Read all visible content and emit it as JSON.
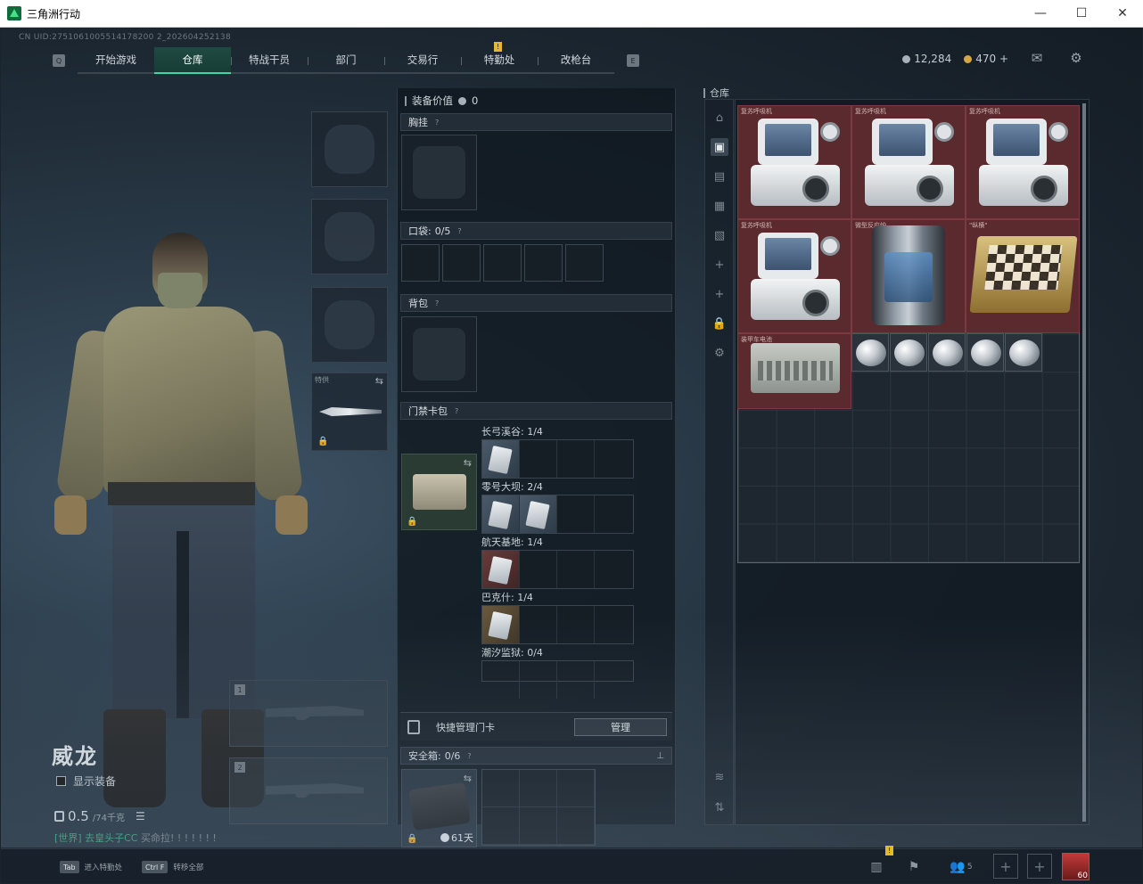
{
  "window": {
    "title": "三角洲行动",
    "minimize": "—",
    "maximize": "☐",
    "close": "✕"
  },
  "uid": "CN UID:2751061005514178200 2_202604252138",
  "nav": {
    "left_key": "Q",
    "right_key": "E",
    "tabs": [
      "开始游戏",
      "仓库",
      "特战干员",
      "部门",
      "交易行",
      "特勤处",
      "改枪台"
    ],
    "active_tab": "仓库",
    "alert_badge": "!"
  },
  "currency": {
    "silver": "12,284",
    "gold": "470 +"
  },
  "icons": {
    "mail": "mail-icon",
    "settings": "gear-icon"
  },
  "character": {
    "name": "威龙",
    "show_gear_label": "显示装备",
    "weight_value": "0.5",
    "weight_capacity": "/74千克",
    "chat_channel": "[世界] 去皇头子CC",
    "chat_message": "买命拉! ! ! ! ! ! !"
  },
  "equipment": {
    "melee_label": "特供",
    "swap_glyph": "⇆",
    "weapon_slot_1": "1",
    "weapon_slot_2": "2"
  },
  "gear_panel": {
    "value_label": "装备价值",
    "value": "0",
    "chest_rig": "胸挂",
    "pockets_label": "口袋:",
    "pockets_count": "0/5",
    "backpack": "背包",
    "keycard_case": "门禁卡包",
    "maps": [
      {
        "name": "长弓溪谷: 1/4"
      },
      {
        "name": "零号大坝: 2/4"
      },
      {
        "name": "航天基地: 1/4"
      },
      {
        "name": "巴克什: 1/4"
      },
      {
        "name": "潮汐监狱: 0/4"
      }
    ],
    "quick_manage_label": "快捷管理门卡",
    "manage_button": "管理",
    "safebox_label": "安全箱:",
    "safebox_count": "0/6",
    "safebox_days": "61天",
    "pin_glyph": "📌",
    "help_glyph": "?"
  },
  "warehouse": {
    "label": "仓库",
    "items": [
      {
        "name": "复苏呼吸机",
        "kind": "monitor"
      },
      {
        "name": "复苏呼吸机",
        "kind": "monitor"
      },
      {
        "name": "复苏呼吸机",
        "kind": "monitor"
      },
      {
        "name": "复苏呼吸机",
        "kind": "monitor"
      },
      {
        "name": "微型反应炉",
        "kind": "reactor"
      },
      {
        "name": "\"纵横\"",
        "kind": "chess"
      },
      {
        "name": "装甲车电池",
        "kind": "battery"
      }
    ],
    "diamond_count": 5
  },
  "bottom_bar": {
    "hotkey1_key": "Tab",
    "hotkey1_label": "进入特勤处",
    "hotkey2_key": "Ctrl F",
    "hotkey2_label": "转移全部",
    "friends_count": "5",
    "player_level": "60",
    "alert_badge": "!"
  }
}
